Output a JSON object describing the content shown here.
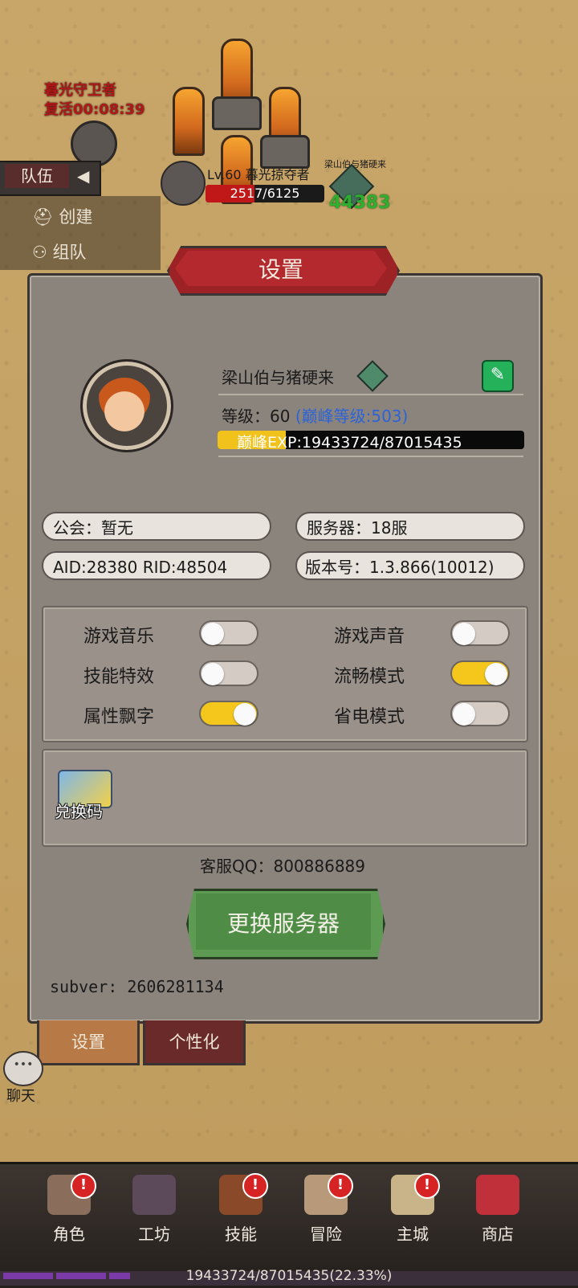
{
  "world": {
    "boss_name": "暮光守卫者",
    "boss_timer": "复活00:08:39",
    "team_tab": "队伍",
    "side_items": [
      {
        "label": "创建",
        "icon": "helmet-icon"
      },
      {
        "label": "组队",
        "icon": "group-icon"
      }
    ],
    "enemy_level": "Lv.60 暮光掠夺者",
    "enemy_hp": "2517/6125",
    "enemy_hp_fraction": 0.41,
    "player_tag_name": "梁山伯与猪硬来",
    "player_tag_power": "44383"
  },
  "dialog": {
    "title": "设置",
    "player_name": "梁山伯与猪硬来",
    "level_label": "等级：60 ",
    "peak_level": "(巅峰等级:503)",
    "exp_text": "巅峰EXP:19433724/87015435",
    "exp_fraction": 0.2233,
    "guild": "公会：暂无",
    "server": "服务器：18服",
    "ids": "AID:28380  RID:48504",
    "version": "版本号：1.3.866(10012)",
    "toggles": [
      {
        "label": "游戏音乐",
        "on": false
      },
      {
        "label": "游戏声音",
        "on": false
      },
      {
        "label": "技能特效",
        "on": false
      },
      {
        "label": "流畅模式",
        "on": true
      },
      {
        "label": "属性飘字",
        "on": true
      },
      {
        "label": "省电模式",
        "on": false
      }
    ],
    "redeem_label": "兑换码",
    "support_qq": "客服QQ：800886889",
    "change_server": "更换服务器",
    "subver": "subver: 2606281134"
  },
  "tabs": {
    "settings": "设置",
    "personalize": "个性化"
  },
  "chat_label": "聊天",
  "bottom_nav": [
    {
      "label": "角色",
      "icon": "hero-icon",
      "badge": "!"
    },
    {
      "label": "工坊",
      "icon": "anvil-icon",
      "badge": ""
    },
    {
      "label": "技能",
      "icon": "skill-book-icon",
      "badge": "!"
    },
    {
      "label": "冒险",
      "icon": "map-scroll-icon",
      "badge": "!"
    },
    {
      "label": "主城",
      "icon": "castle-icon",
      "badge": "!"
    },
    {
      "label": "商店",
      "icon": "shop-icon",
      "badge": ""
    }
  ],
  "bottom_exp": "19433724/87015435(22.33%)",
  "colors": {
    "accent_red": "#b3292e",
    "toggle_on": "#f5c61c",
    "button_green": "#5d9a52",
    "peak_blue": "#2d63d6"
  }
}
